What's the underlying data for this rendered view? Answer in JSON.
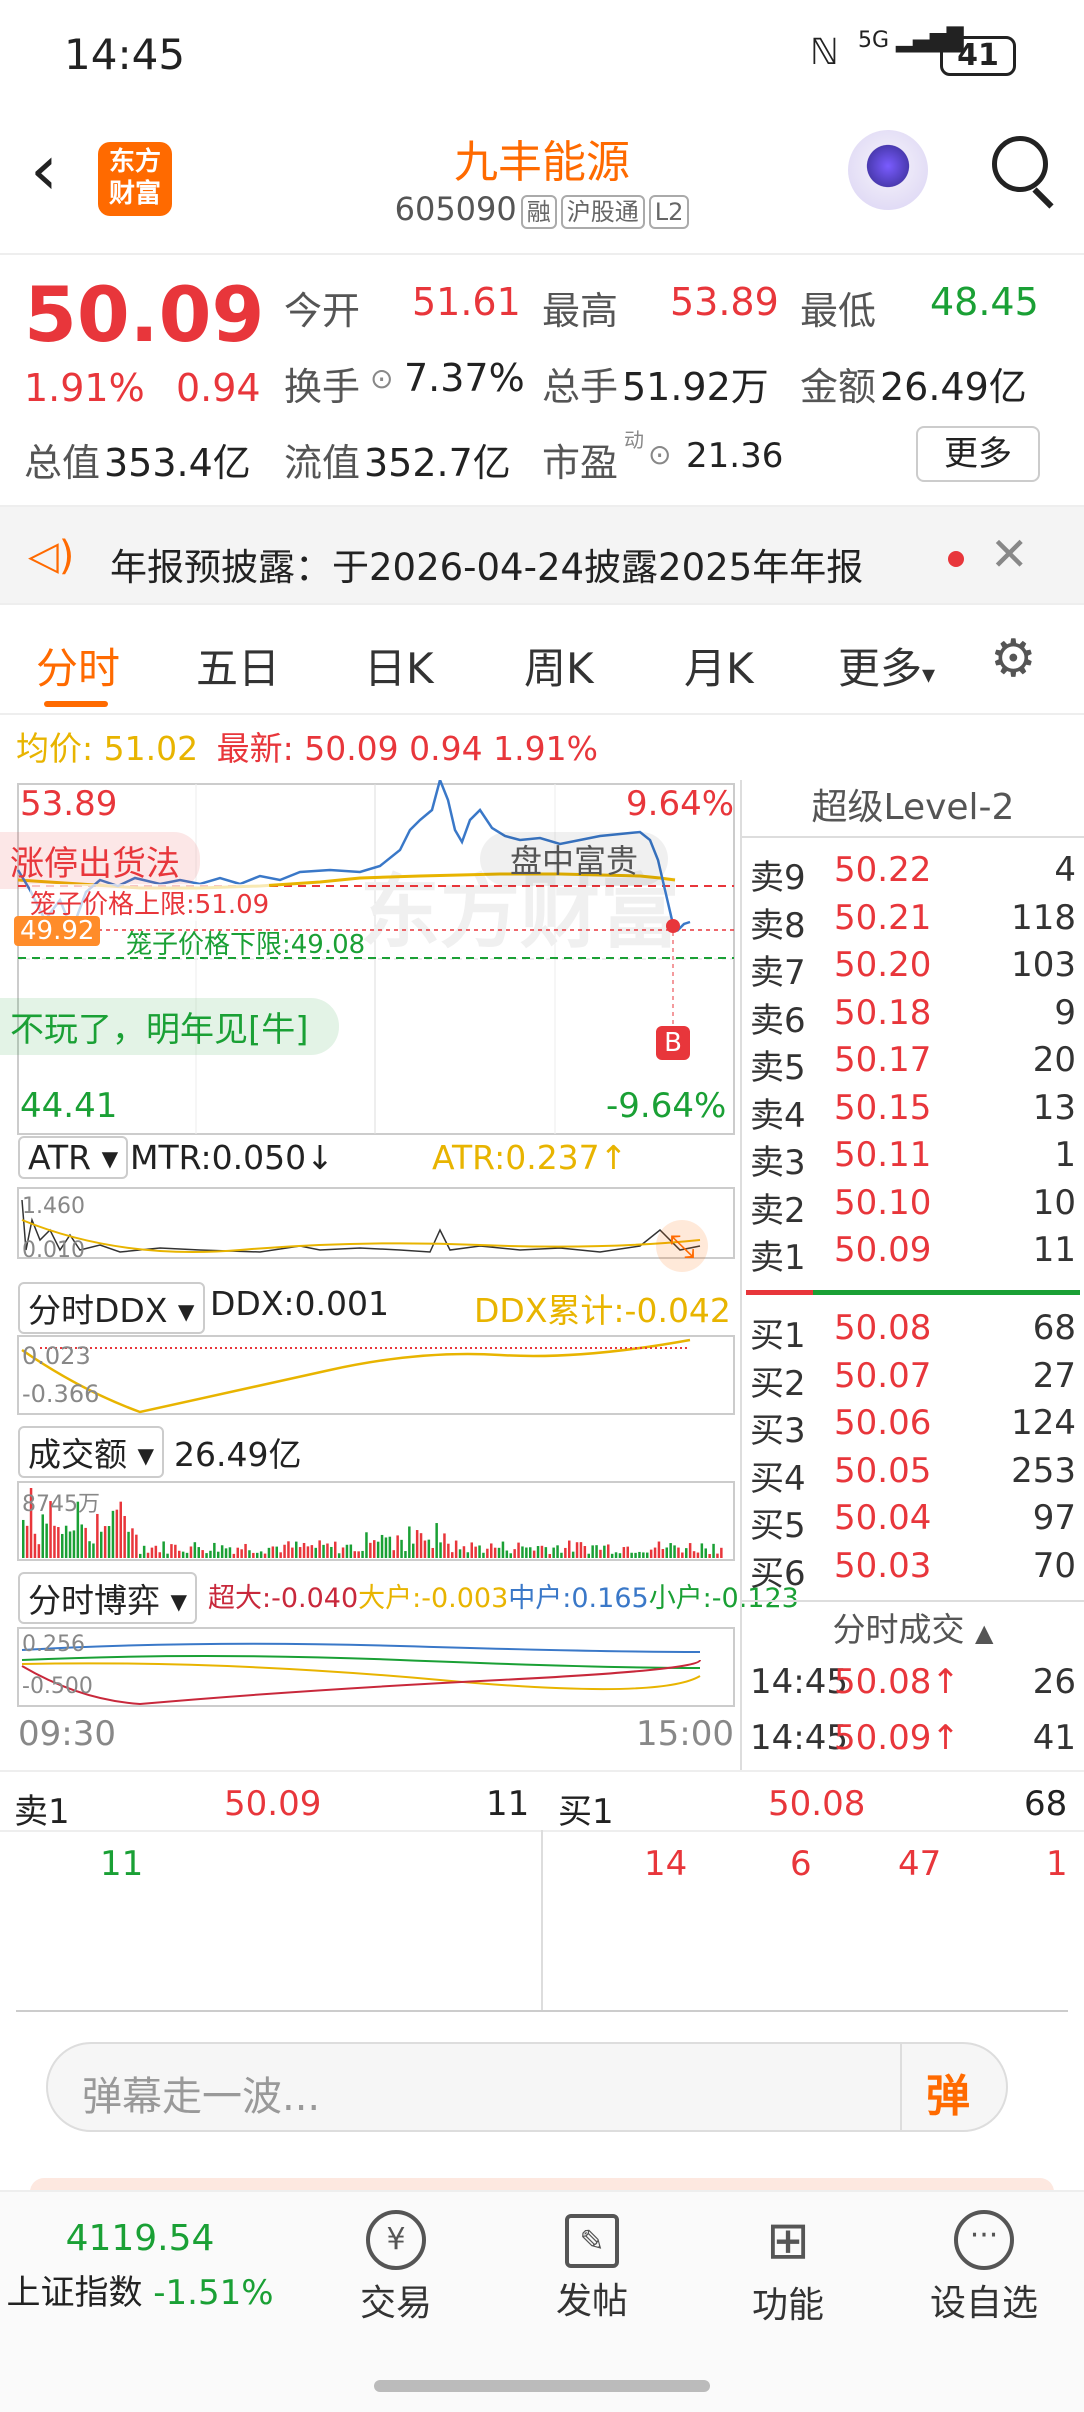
{
  "status": {
    "time": "14:45",
    "network": "5G",
    "battery": "41"
  },
  "header": {
    "title": "九丰能源",
    "code": "605090",
    "tags": [
      "融",
      "沪股通",
      "L2"
    ],
    "logo_top": "东方",
    "logo_bottom": "财富"
  },
  "quote": {
    "price": "50.09",
    "pct": "1.91%",
    "chg": "0.94",
    "open_label": "今开",
    "open": "51.61",
    "high_label": "最高",
    "high": "53.89",
    "low_label": "最低",
    "low": "48.45",
    "turnover_label": "换手",
    "turnover": "7.37%",
    "volume_label": "总手",
    "volume": "51.92万",
    "amount_label": "金额",
    "amount": "26.49亿",
    "mktcap_label": "总值",
    "mktcap": "353.4亿",
    "float_label": "流值",
    "float": "352.7亿",
    "pe_label": "市盈",
    "pe_sup": "动",
    "pe": "21.36",
    "more": "更多"
  },
  "notice": {
    "text": "年报预披露：于2026-04-24披露2025年年报"
  },
  "tabs": [
    "分时",
    "五日",
    "日K",
    "周K",
    "月K",
    "更多"
  ],
  "legend": {
    "avg": "均价: 51.02",
    "latest": "最新: 50.09 0.94 1.91%"
  },
  "chart": {
    "max_price": "53.89",
    "max_pct": "9.64%",
    "min_price": "44.41",
    "min_pct": "-9.64%",
    "watermark": "盘中富贵",
    "danmu": [
      "涨停出货法",
      "不玩了，明年见[牛]"
    ],
    "cage_upper": "笼子价格上限:51.09",
    "cage_lower": "笼子价格下限:49.08",
    "price_tag": "49.92",
    "b_marker": "B",
    "atr_sel": "ATR",
    "mtr": "MTR:0.050↓",
    "atr": "ATR:0.237↑",
    "atr_top": "1.460",
    "atr_bot": "0.010",
    "ddx_sel": "分时DDX",
    "ddx": "DDX:0.001",
    "ddx_sum": "DDX累计:-0.042",
    "ddx_top": "0.023",
    "ddx_bot": "-0.366",
    "vol_sel": "成交额",
    "vol": "26.49亿",
    "vol_top": "8745万",
    "game_sel": "分时博弈",
    "game_big": "超大:-0.040",
    "game_large": "大户:-0.003",
    "game_mid": "中户:0.165",
    "game_small": "小户:-0.123",
    "game_top": "0.256",
    "game_bot": "-0.500",
    "time_start": "09:30",
    "time_end": "15:00"
  },
  "level2": {
    "title": "超级Level-2",
    "asks": [
      [
        "卖9",
        "50.22",
        "4"
      ],
      [
        "卖8",
        "50.21",
        "118"
      ],
      [
        "卖7",
        "50.20",
        "103"
      ],
      [
        "卖6",
        "50.18",
        "9"
      ],
      [
        "卖5",
        "50.17",
        "20"
      ],
      [
        "卖4",
        "50.15",
        "13"
      ],
      [
        "卖3",
        "50.11",
        "1"
      ],
      [
        "卖2",
        "50.10",
        "10"
      ],
      [
        "卖1",
        "50.09",
        "11"
      ]
    ],
    "bids": [
      [
        "买1",
        "50.08",
        "68"
      ],
      [
        "买2",
        "50.07",
        "27"
      ],
      [
        "买3",
        "50.06",
        "124"
      ],
      [
        "买4",
        "50.05",
        "253"
      ],
      [
        "买5",
        "50.04",
        "97"
      ],
      [
        "买6",
        "50.03",
        "70"
      ]
    ],
    "trades_title": "分时成交",
    "trades": [
      [
        "14:45",
        "50.08↑",
        "26"
      ],
      [
        "14:45",
        "50.09↑",
        "41"
      ]
    ]
  },
  "ticks": {
    "ask_label": "卖1",
    "ask_price": "50.09",
    "ask_qty": "11",
    "bid_label": "买1",
    "bid_price": "50.08",
    "bid_qty": "68",
    "ask_queue": [
      "11"
    ],
    "bid_queue": [
      "14",
      "6",
      "47",
      "1"
    ]
  },
  "danmu_input": {
    "placeholder": "弹幕走一波...",
    "send": "弹"
  },
  "bottom": {
    "index_value": "4119.54",
    "index_name": "上证指数",
    "index_pct": "-1.51%",
    "nav": [
      "交易",
      "发帖",
      "功能",
      "设自选"
    ]
  },
  "colors": {
    "red": "#e8363b",
    "green": "#1aa035",
    "orange": "#ff6a00",
    "gold": "#e8b400"
  }
}
